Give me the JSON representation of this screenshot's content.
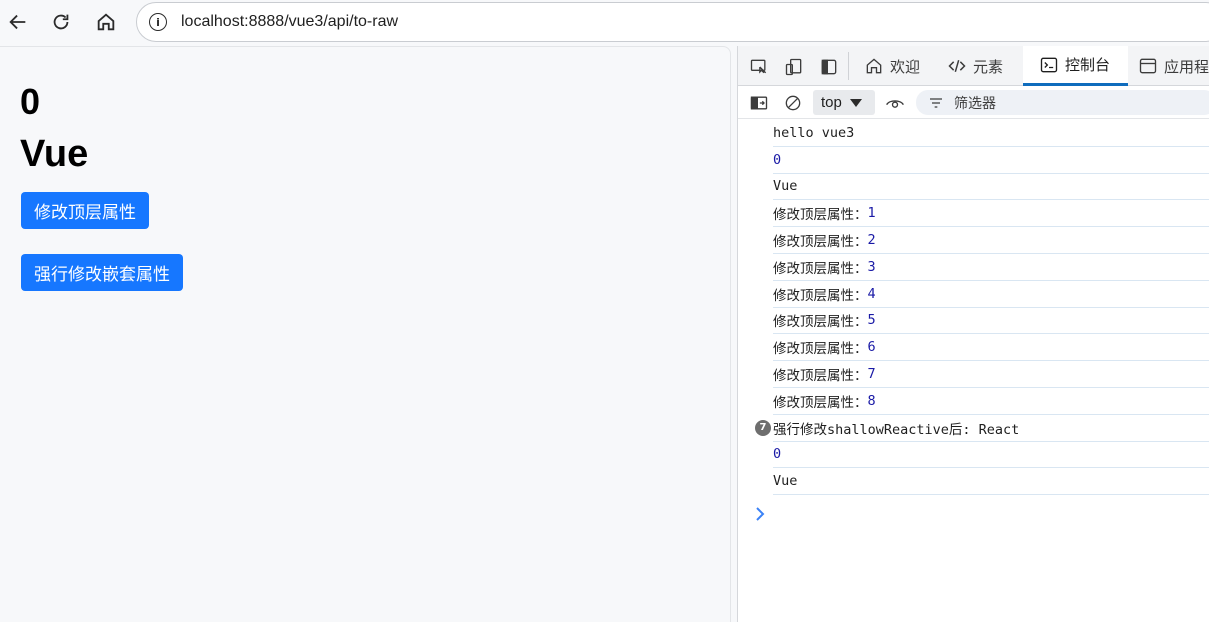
{
  "browser": {
    "url": "localhost:8888/vue3/api/to-raw"
  },
  "page": {
    "count": "0",
    "name": "Vue",
    "button_top": "修改顶层属性",
    "button_nested": "强行修改嵌套属性"
  },
  "devtools": {
    "tabs": [
      {
        "label": "欢迎",
        "icon": "home-icon"
      },
      {
        "label": "元素",
        "icon": "code-icon"
      },
      {
        "label": "控制台",
        "icon": "console-icon"
      },
      {
        "label": "应用程",
        "icon": "application-icon"
      }
    ],
    "context": "top",
    "filter_placeholder": "筛选器",
    "console_rows": [
      {
        "text": "hello vue3",
        "value": ""
      },
      {
        "text": "",
        "value": "0"
      },
      {
        "text": "Vue",
        "value": ""
      },
      {
        "text": "修改顶层属性：",
        "value": "1"
      },
      {
        "text": "修改顶层属性：",
        "value": "2"
      },
      {
        "text": "修改顶层属性：",
        "value": "3"
      },
      {
        "text": "修改顶层属性：",
        "value": "4"
      },
      {
        "text": "修改顶层属性：",
        "value": "5"
      },
      {
        "text": "修改顶层属性：",
        "value": "6"
      },
      {
        "text": "修改顶层属性：",
        "value": "7"
      },
      {
        "text": "修改顶层属性：",
        "value": "8"
      },
      {
        "text": "强行修改shallowReactive后: React",
        "value": "",
        "badge": "7"
      },
      {
        "text": "",
        "value": "0"
      },
      {
        "text": "Vue",
        "value": ""
      }
    ]
  },
  "colors": {
    "accent": "#1677ff",
    "console_number": "#1a1aa6",
    "active_tab": "#0f6cbd"
  }
}
